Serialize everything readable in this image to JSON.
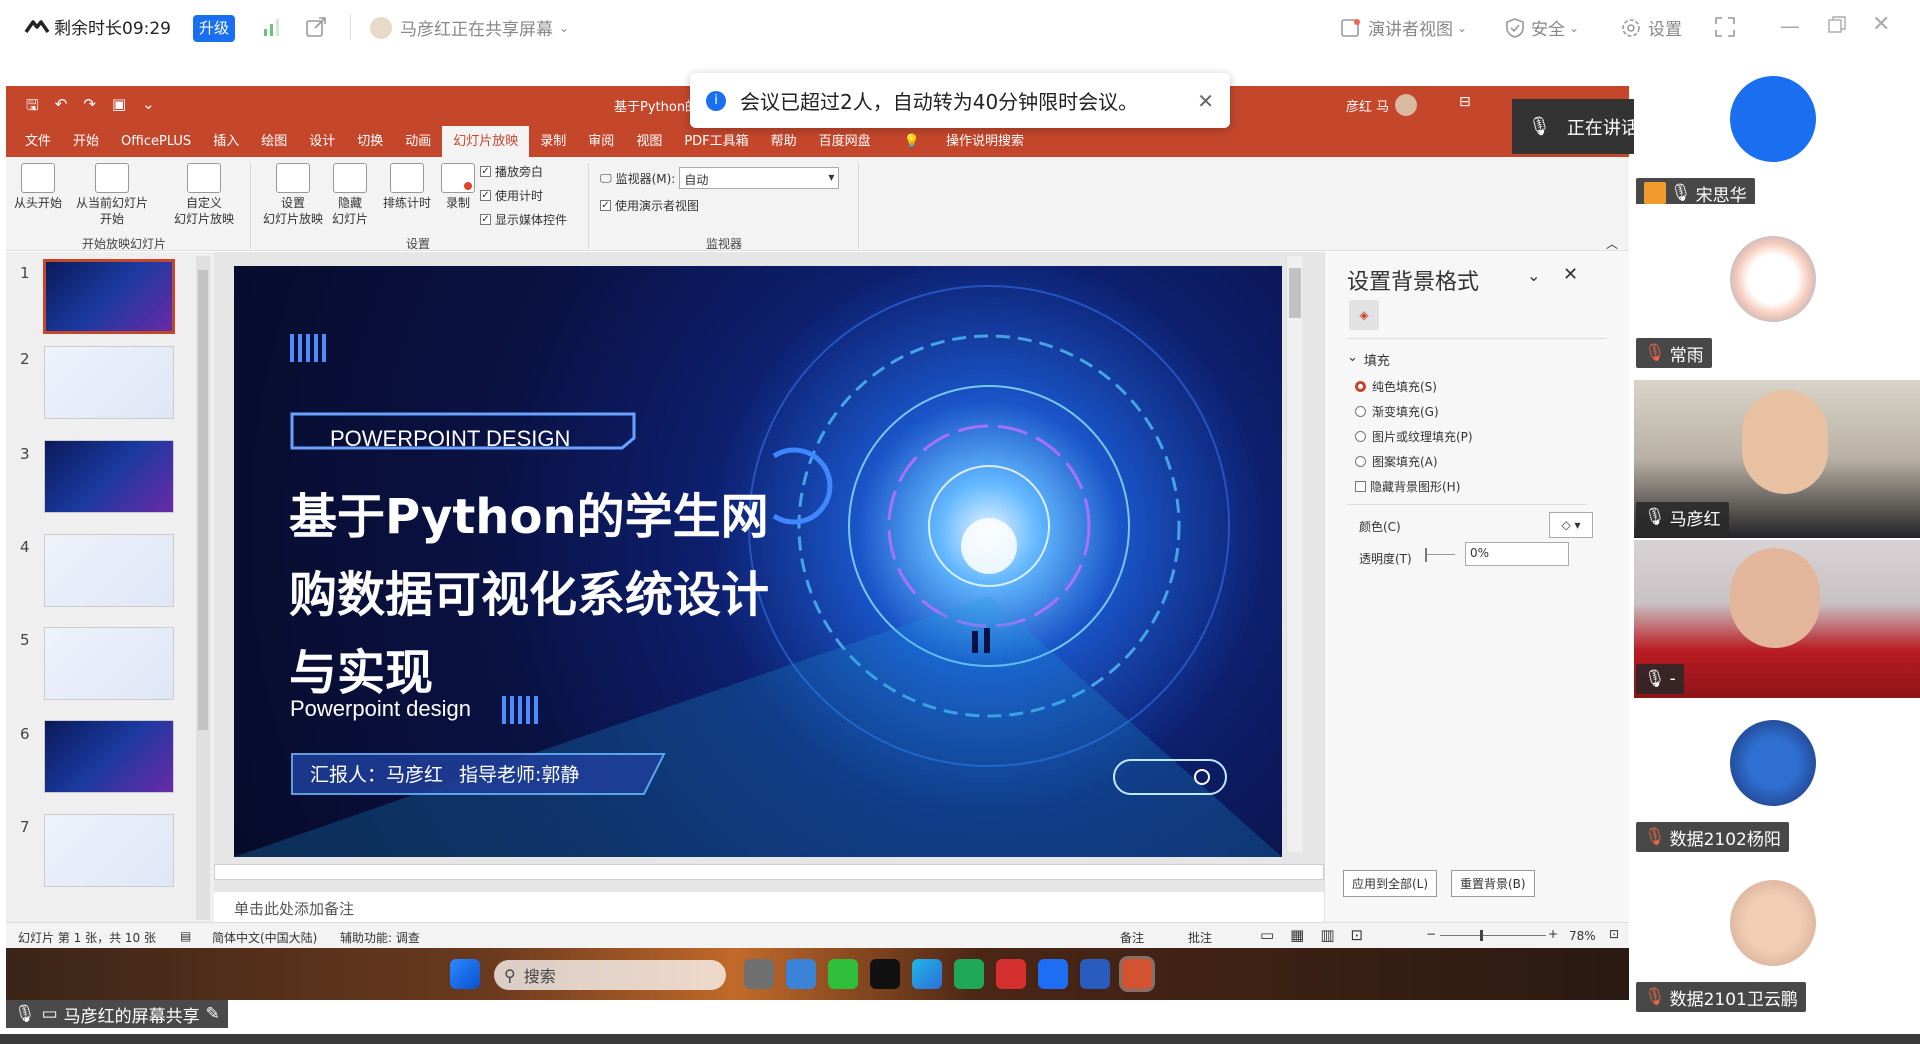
{
  "topbar": {
    "remaining_label": "剩余时长09:29",
    "upgrade_label": "升级",
    "sharing_label": "马彦红正在共享屏幕",
    "presenter_view": "演讲者视图",
    "security": "安全",
    "settings": "设置"
  },
  "toast": {
    "message": "会议已超过2人，自动转为40分钟限时会议。"
  },
  "speaking": {
    "label": "正在讲话:"
  },
  "ppt": {
    "title": "基于Python的",
    "user": "彦红 马",
    "tabs": [
      "文件",
      "开始",
      "OfficePLUS",
      "插入",
      "绘图",
      "设计",
      "切换",
      "动画",
      "幻灯片放映",
      "录制",
      "审阅",
      "视图",
      "PDF工具箱",
      "帮助",
      "百度网盘"
    ],
    "active_tab": "幻灯片放映",
    "tell_me": "操作说明搜索",
    "ribbon": {
      "from_start": "从头开始",
      "from_current_1": "从当前幻灯片",
      "from_current_2": "开始",
      "custom_1": "自定义",
      "custom_2": "幻灯片放映",
      "group_start": "开始放映幻灯片",
      "setup_1": "设置",
      "setup_2": "幻灯片放映",
      "hide_1": "隐藏",
      "hide_2": "幻灯片",
      "rehearse": "排练计时",
      "record": "录制",
      "chk_narration": "播放旁白",
      "chk_timing": "使用计时",
      "chk_media": "显示媒体控件",
      "group_setup": "设置",
      "monitor_label": "监视器(M):",
      "monitor_value": "自动",
      "presenter_chk": "使用演示者视图",
      "group_monitor": "监视器"
    },
    "thumb_numbers": [
      "1",
      "2",
      "3",
      "4",
      "5",
      "6",
      "7"
    ],
    "slide": {
      "tag": "POWERPOINT DESIGN",
      "title_line1": "基于Python的学生网",
      "title_line2": "购数据可视化系统设计",
      "title_line3": "与实现",
      "subtitle": "Powerpoint design",
      "reporter_label": "汇报人：马彦红",
      "advisor_label": "指导老师",
      "advisor_name": ":郭静"
    },
    "notes_placeholder": "单击此处添加备注",
    "format_pane": {
      "title": "设置背景格式",
      "fill_section": "填充",
      "solid": "纯色填充(S)",
      "gradient": "渐变填充(G)",
      "picture": "图片或纹理填充(P)",
      "pattern": "图案填充(A)",
      "hide_bg": "隐藏背景图形(H)",
      "color_label": "颜色(C)",
      "transparency_label": "透明度(T)",
      "transparency_value": "0%",
      "apply_all": "应用到全部(L)",
      "reset": "重置背景(B)"
    },
    "status": {
      "slide_info": "幻灯片 第 1 张，共 10 张",
      "language": "简体中文(中国大陆)",
      "accessibility": "辅助功能: 调查",
      "notes": "备注",
      "comments": "批注",
      "zoom": "78%"
    },
    "taskbar": {
      "search_placeholder": "搜索"
    }
  },
  "sharebar": {
    "label": "马彦红的屏幕共享"
  },
  "participants": [
    {
      "name": "宋思华"
    },
    {
      "name": "常雨"
    },
    {
      "name": "马彦红"
    },
    {
      "name": "-"
    },
    {
      "name": "数据2102杨阳"
    },
    {
      "name": "数据2101卫云鹏"
    }
  ],
  "colors": {
    "accent": "#c4472c",
    "meeting_blue": "#1a6ff0"
  }
}
